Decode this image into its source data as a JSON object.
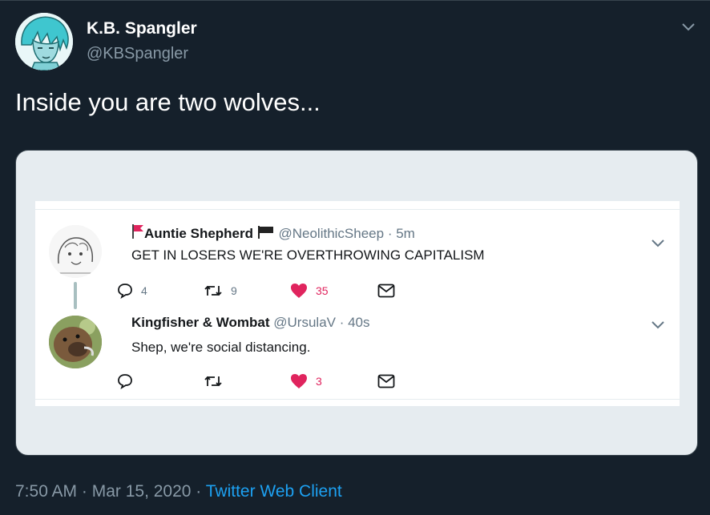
{
  "tweet": {
    "author": {
      "display_name": "K.B. Spangler",
      "handle": "@KBSpangler",
      "avatar_icon": "avatar-teal-hair-portrait"
    },
    "text": "Inside you are two wolves...",
    "timestamp": "7:50 AM · Mar 15, 2020 · ",
    "client": "Twitter Web Client",
    "menu_icon": "chevron-down-icon"
  },
  "embedded_thread": {
    "tweets": [
      {
        "display_name": "Auntie Shepherd",
        "name_prefix_icon": "red-flag-icon",
        "name_suffix_icon": "black-flag-icon",
        "handle_and_time": "@NeolithicSheep · 5m",
        "text": "GET IN LOSERS WE'RE OVERTHROWING CAPITALISM",
        "reply_count": "4",
        "retweet_count": "9",
        "like_count": "35",
        "liked": true
      },
      {
        "display_name": "Kingfisher & Wombat",
        "handle_and_time": "@UrsulaV · 40s",
        "text": "Shep, we're social distancing.",
        "reply_count": "",
        "retweet_count": "",
        "like_count": "3",
        "liked": true
      }
    ]
  },
  "colors": {
    "background": "#15202b",
    "secondary_text": "#8899a6",
    "link": "#1da1f2",
    "like": "#e0245e",
    "action_gray": "#657786"
  }
}
